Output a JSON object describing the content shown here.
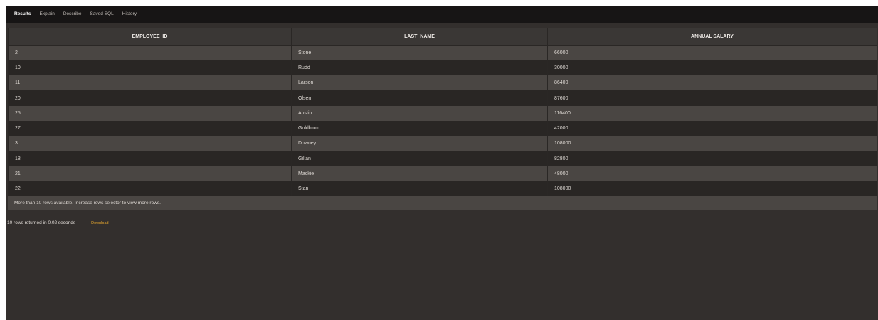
{
  "tabs": [
    "Results",
    "Explain",
    "Describe",
    "Saved SQL",
    "History"
  ],
  "columns": [
    "EMPLOYEE_ID",
    "LAST_NAME",
    "ANNUAL SALARY"
  ],
  "rows": [
    [
      "2",
      "Stone",
      "66000"
    ],
    [
      "10",
      "Rudd",
      "30000"
    ],
    [
      "11",
      "Larson",
      "86400"
    ],
    [
      "20",
      "Olsen",
      "87600"
    ],
    [
      "25",
      "Austin",
      "116400"
    ],
    [
      "27",
      "Goldblum",
      "42000"
    ],
    [
      "3",
      "Downey",
      "108000"
    ],
    [
      "18",
      "Gillan",
      "82800"
    ],
    [
      "21",
      "Mackie",
      "48000"
    ],
    [
      "22",
      "Stan",
      "108000"
    ]
  ],
  "more_rows_note": "More than 10 rows available. Increase rows selector to view more rows.",
  "status_text": "10 rows returned in 0.02 seconds",
  "download_label": "Download",
  "colors": {
    "tab_bar": "#171515",
    "panel": "#332f2d",
    "row_odd": "#4a4643",
    "row_even": "#292624",
    "download_link": "#e3a52e"
  }
}
